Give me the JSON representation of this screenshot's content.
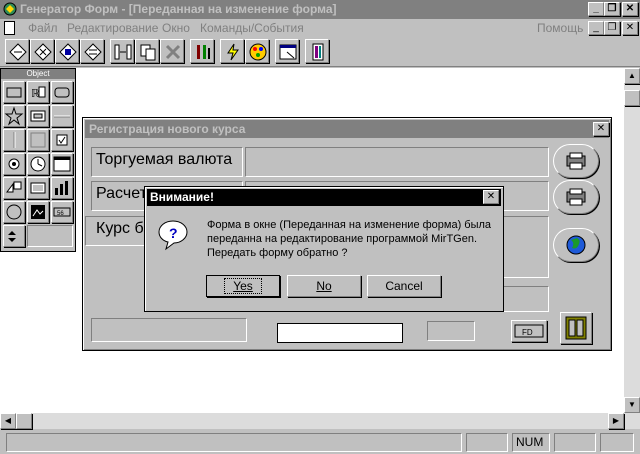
{
  "app": {
    "title": "Генератор Форм - [Переданная на изменение форма]"
  },
  "menu": {
    "items": [
      "Файл",
      "Редактирование",
      "Окно",
      "Команды/События"
    ],
    "help": "Помощь"
  },
  "palette": {
    "title": "Object"
  },
  "form": {
    "title": "Регистрация нового курса",
    "label1": "Торгуемая валюта",
    "label2": "Расчет",
    "label3": "Курс б",
    "fd_label": "FD"
  },
  "dialog": {
    "title": "Внимание!",
    "line1": "Форма в окне (Переданная на изменение форма) была",
    "line2": "переданна на редактирование программой MirTGen.",
    "line3": "Передать форму обратно ?",
    "yes": "Yes",
    "no": "No",
    "cancel": "Cancel"
  },
  "status": {
    "num": "NUM"
  }
}
